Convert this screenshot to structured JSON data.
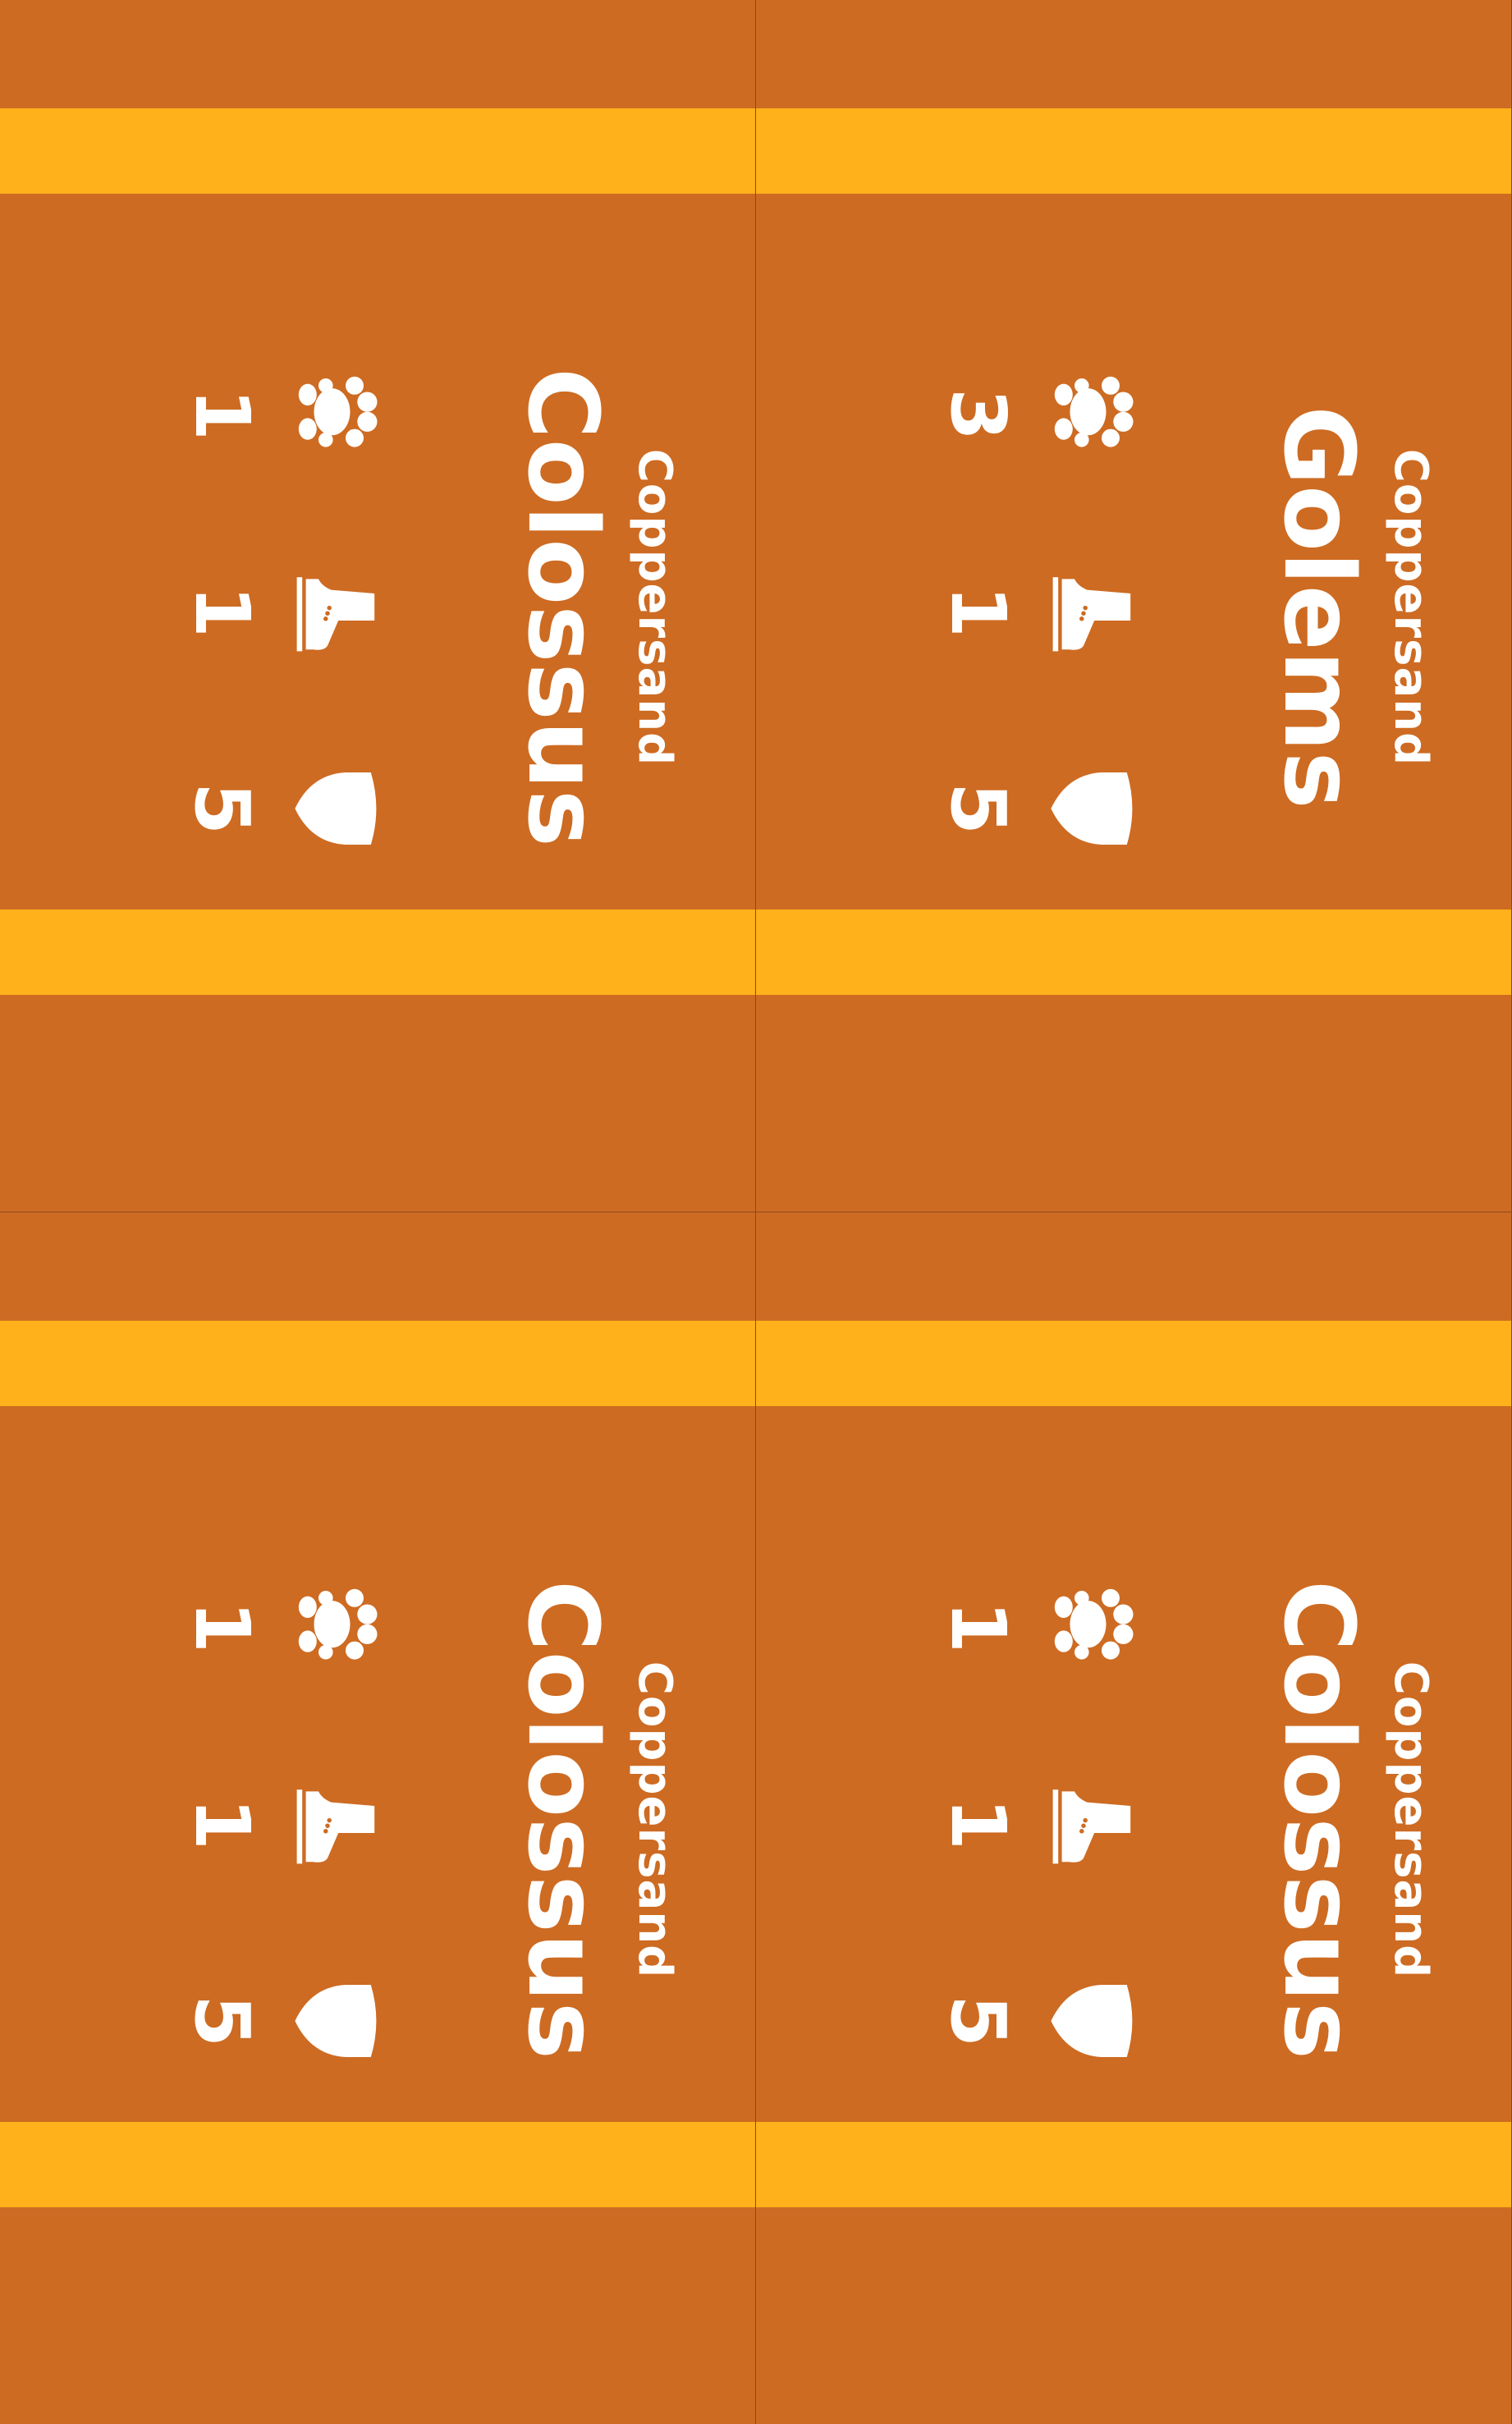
{
  "colors": {
    "card": "#cd6b22",
    "band": "#feb11a",
    "text": "#ffffff"
  },
  "cards": [
    {
      "faction": "Coppersand",
      "unit": "Colossus",
      "stats": {
        "group": "1",
        "move": "1",
        "defense": "5"
      }
    },
    {
      "faction": "Coppersand",
      "unit": "Golems",
      "stats": {
        "group": "3",
        "move": "1",
        "defense": "5"
      }
    },
    {
      "faction": "Coppersand",
      "unit": "Colossus",
      "stats": {
        "group": "1",
        "move": "1",
        "defense": "5"
      }
    },
    {
      "faction": "Coppersand",
      "unit": "Colossus",
      "stats": {
        "group": "1",
        "move": "1",
        "defense": "5"
      }
    }
  ],
  "icons": {
    "group": "group-paw-icon",
    "move": "boot-icon",
    "defense": "shield-icon"
  }
}
